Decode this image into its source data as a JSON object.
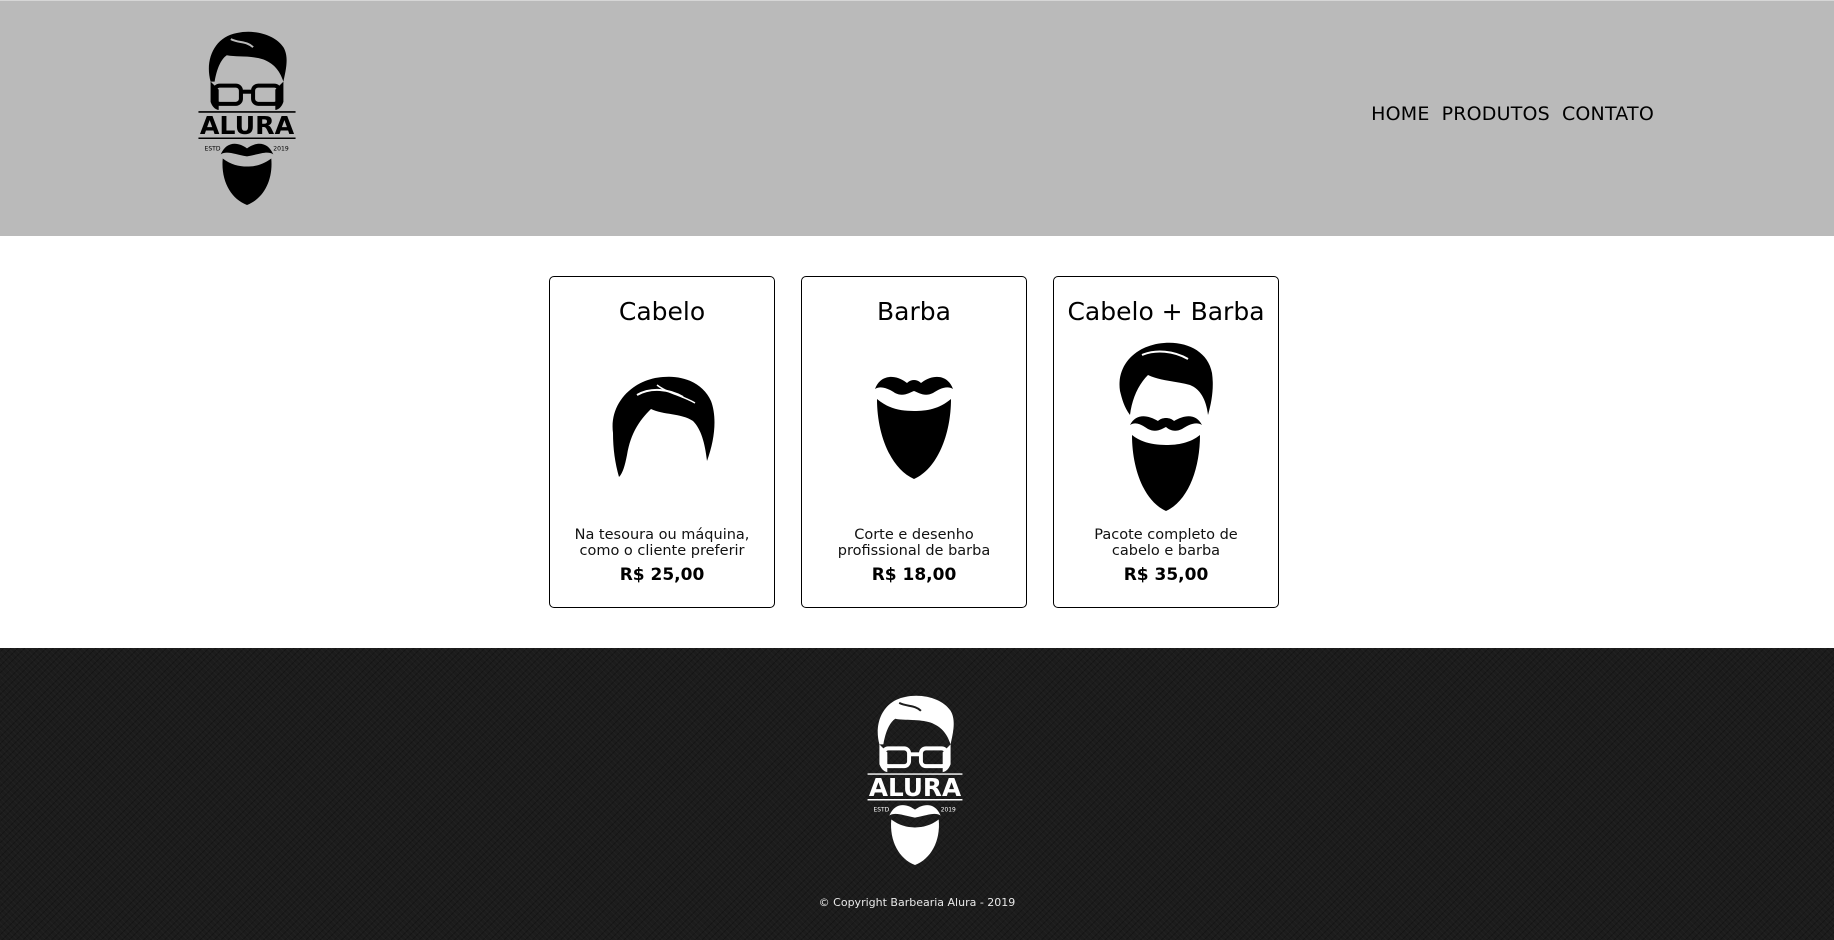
{
  "header": {
    "logo": {
      "brand": "ALURA",
      "left_text": "ESTD",
      "right_text": "2019"
    },
    "nav": [
      {
        "label": "HOME"
      },
      {
        "label": "PRODUTOS"
      },
      {
        "label": "CONTATO"
      }
    ]
  },
  "products": [
    {
      "title": "Cabelo",
      "icon": "hair-icon",
      "desc_line1": "Na tesoura ou máquina,",
      "desc_line2": "como o cliente preferir",
      "price": "R$ 25,00"
    },
    {
      "title": "Barba",
      "icon": "beard-icon",
      "desc_line1": "Corte e desenho",
      "desc_line2": "profissional de barba",
      "price": "R$ 18,00"
    },
    {
      "title": "Cabelo + Barba",
      "icon": "hair-and-beard-icon",
      "desc_line1": "Pacote completo de",
      "desc_line2": "cabelo e barba",
      "price": "R$ 35,00"
    }
  ],
  "footer": {
    "logo": {
      "brand": "ALURA",
      "left_text": "ESTD",
      "right_text": "2019"
    },
    "copyright": "© Copyright Barbearia Alura - 2019"
  },
  "colors": {
    "header_bg": "#bababa",
    "footer_bg": "#1c1c1c",
    "text": "#000000"
  }
}
